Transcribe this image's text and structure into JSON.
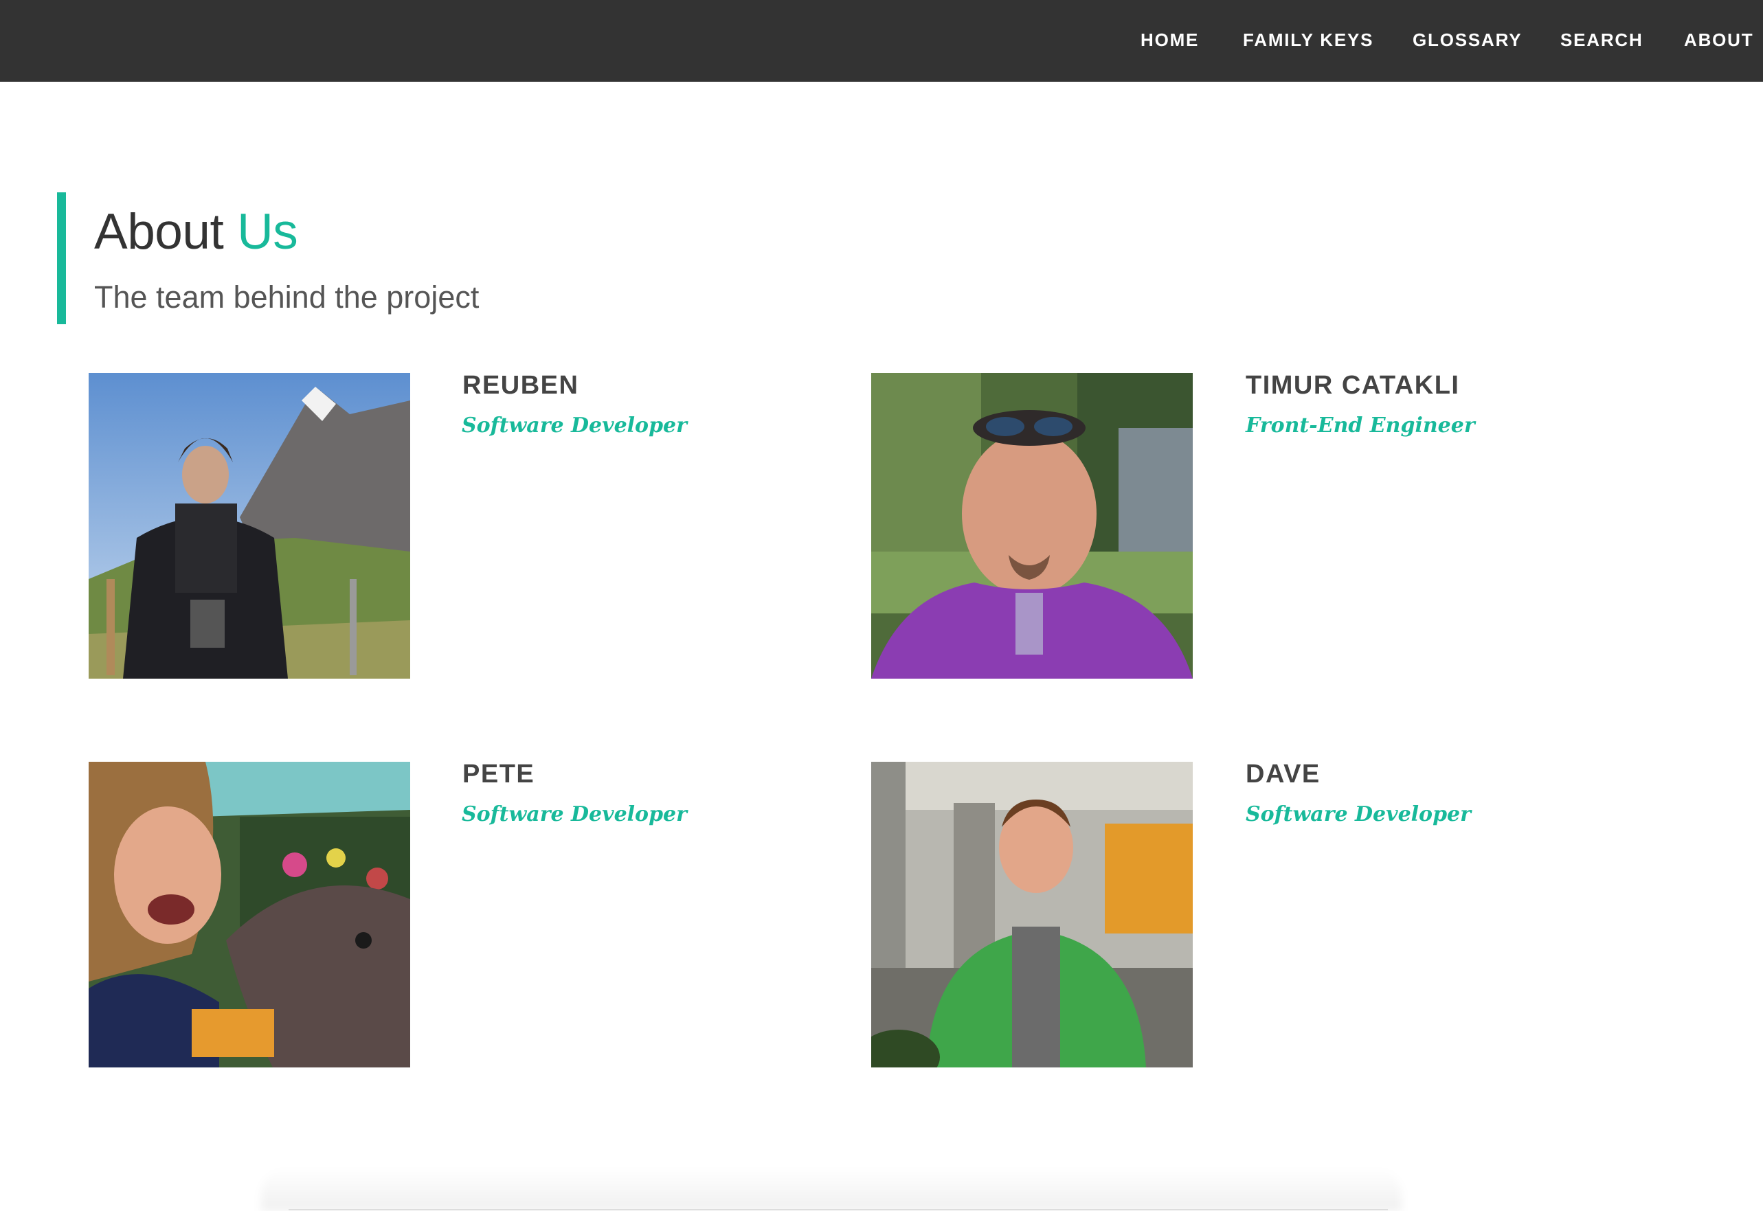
{
  "nav": {
    "items": [
      {
        "label": "HOME"
      },
      {
        "label": "FAMILY KEYS"
      },
      {
        "label": "GLOSSARY"
      },
      {
        "label": "SEARCH"
      },
      {
        "label": "ABOUT"
      }
    ]
  },
  "header": {
    "title_main": "About",
    "title_accent": "Us",
    "subtitle": "The team behind the project"
  },
  "team": [
    {
      "name": "REUBEN",
      "role": "Software Developer",
      "photo_icon": "mountain-hiker-photo"
    },
    {
      "name": "TIMUR CATAKLI",
      "role": "Front-End Engineer",
      "photo_icon": "portrait-photo"
    },
    {
      "name": "PETE",
      "role": "Software Developer",
      "photo_icon": "elephant-photo"
    },
    {
      "name": "DAVE",
      "role": "Software Developer",
      "photo_icon": "office-portrait-photo"
    }
  ],
  "colors": {
    "accent": "#18b99a",
    "navbar": "#333333",
    "heading": "#333333"
  }
}
